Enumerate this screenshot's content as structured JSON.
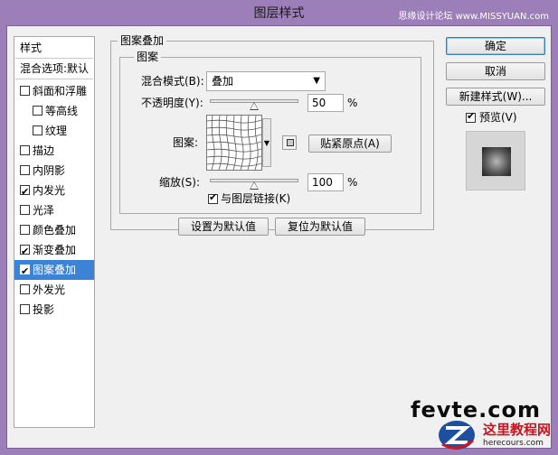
{
  "window": {
    "title": "图层样式",
    "watermark": "思缘设计论坛 www.MISSYUAN.com"
  },
  "left_list": {
    "header": "样式",
    "blend_options": "混合选项:默认",
    "items": [
      {
        "label": "斜面和浮雕",
        "checked": false,
        "selected": false
      },
      {
        "label": "等高线",
        "checked": false,
        "selected": false
      },
      {
        "label": "纹理",
        "checked": false,
        "selected": false
      },
      {
        "label": "描边",
        "checked": false,
        "selected": false
      },
      {
        "label": "内阴影",
        "checked": false,
        "selected": false
      },
      {
        "label": "内发光",
        "checked": true,
        "selected": false
      },
      {
        "label": "光泽",
        "checked": false,
        "selected": false
      },
      {
        "label": "颜色叠加",
        "checked": false,
        "selected": false
      },
      {
        "label": "渐变叠加",
        "checked": true,
        "selected": false
      },
      {
        "label": "图案叠加",
        "checked": true,
        "selected": true
      },
      {
        "label": "外发光",
        "checked": false,
        "selected": false
      },
      {
        "label": "投影",
        "checked": false,
        "selected": false
      }
    ]
  },
  "panel": {
    "outer_title": "图案叠加",
    "inner_title": "图案",
    "blend_mode_label": "混合模式(B):",
    "blend_mode_value": "叠加",
    "opacity_label": "不透明度(Y):",
    "opacity_value": "50",
    "opacity_percent": 50,
    "percent": "%",
    "pattern_label": "图案:",
    "snap_origin": "贴紧原点(A)",
    "scale_label": "缩放(S):",
    "scale_value": "100",
    "scale_percent": 100,
    "link_label": "与图层链接(K)",
    "link_checked": true,
    "make_default": "设置为默认值",
    "reset_default": "复位为默认值"
  },
  "right": {
    "ok": "确定",
    "cancel": "取消",
    "new_style": "新建样式(W)...",
    "preview_label": "预览(V)",
    "preview_checked": true
  },
  "watermarks": {
    "brand": "fevte.com",
    "site_cn": "这里教程网",
    "site_url": "herecours.com"
  }
}
